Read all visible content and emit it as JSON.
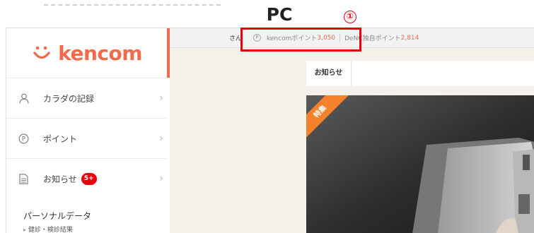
{
  "header": {
    "pc_label": "PC",
    "marker": "①"
  },
  "brand": {
    "logo_text": "kencom",
    "color": "#ee6c4d"
  },
  "sidebar": {
    "items": [
      {
        "icon": "person-icon",
        "label": "カラダの記録"
      },
      {
        "icon": "point-p-icon",
        "label": "ポイント"
      },
      {
        "icon": "document-icon",
        "label": "お知らせ",
        "badge": "5+"
      }
    ],
    "section_title": "パーソナルデータ",
    "section_link": "健診・検診結果"
  },
  "topbar": {
    "user_suffix": "さん",
    "points": [
      {
        "label": "kencomポイント",
        "value": "3,050"
      },
      {
        "label": "DeNC独自ポイント",
        "value": "2,814"
      }
    ]
  },
  "news": {
    "title": "お知らせ"
  },
  "feature": {
    "ribbon": "特集"
  },
  "colors": {
    "accent": "#ee6c4d",
    "highlight": "#e8000b",
    "ribbon": "#f5822a"
  }
}
